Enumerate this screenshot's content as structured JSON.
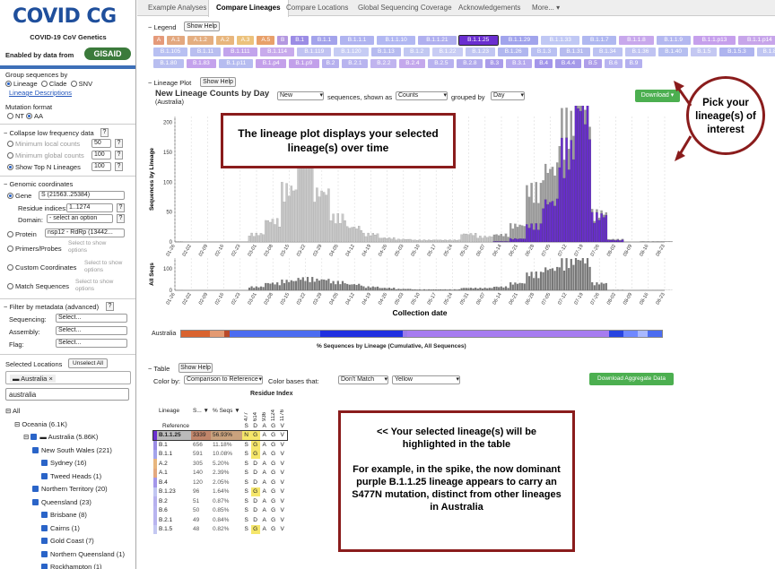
{
  "sidebar": {
    "logo": "COVID CG",
    "subtitle": "COVID-19 CoV Genetics",
    "enabled_by": "Enabled by data from",
    "gisaid": "GISAID",
    "group_seq_label": "Group sequences by",
    "group_options": [
      "Lineage",
      "Clade",
      "SNV"
    ],
    "lineage_desc": "Lineage Descriptions",
    "mutation_format_label": "Mutation format",
    "mutation_options": [
      "NT",
      "AA"
    ],
    "collapse_label": "Collapse low frequency data",
    "min_local_label": "Minimum local counts",
    "min_local_val": "50",
    "min_global_label": "Minimum global counts",
    "min_global_val": "100",
    "top_n_label": "Show Top N Lineages",
    "top_n_val": "100",
    "genomic_label": "Genomic coordinates",
    "gene_label": "Gene",
    "gene_val": "S  (21563..25384)",
    "residue_label": "Residue indices:",
    "residue_val": "1..1274",
    "domain_label": "Domain:",
    "domain_val": "- select an option",
    "protein_label": "Protein",
    "protein_val": "nsp12 - RdRp (13442...",
    "primers_label": "Primers/Probes",
    "custom_label": "Custom Coordinates",
    "match_label": "Match Sequences",
    "select_show": "Select to show options",
    "filter_label": "Filter by metadata (advanced)",
    "sequencing_label": "Sequencing:",
    "assembly_label": "Assembly:",
    "flag_label": "Flag:",
    "select_placeholder": "Select...",
    "selected_loc_label": "Selected Locations",
    "unselect_all": "Unselect All",
    "loc_chip": "Australia",
    "search_val": "australia",
    "tree": [
      {
        "label": "All",
        "indent": 0,
        "type": "minus"
      },
      {
        "label": "Oceania  (6.1K)",
        "indent": 1,
        "type": "minus"
      },
      {
        "label": "Australia  (5.86K)",
        "indent": 2,
        "type": "chkflag"
      },
      {
        "label": "New South Wales  (221)",
        "indent": 3,
        "type": "chk"
      },
      {
        "label": "Sydney  (16)",
        "indent": 4,
        "type": "chk"
      },
      {
        "label": "Tweed Heads  (1)",
        "indent": 4,
        "type": "chk"
      },
      {
        "label": "Northern Territory  (20)",
        "indent": 3,
        "type": "chk"
      },
      {
        "label": "Queensland  (23)",
        "indent": 3,
        "type": "chk"
      },
      {
        "label": "Brisbane  (8)",
        "indent": 4,
        "type": "chk"
      },
      {
        "label": "Cairns  (1)",
        "indent": 4,
        "type": "chk"
      },
      {
        "label": "Gold Coast  (7)",
        "indent": 4,
        "type": "chk"
      },
      {
        "label": "Northern Queensland  (1)",
        "indent": 4,
        "type": "chk"
      },
      {
        "label": "Rockhampton  (1)",
        "indent": 4,
        "type": "chk"
      }
    ]
  },
  "tabs": [
    "Example Analyses",
    "Compare Lineages",
    "Compare Locations",
    "Global Sequencing Coverage",
    "Acknowledgements",
    "More..."
  ],
  "legend": {
    "title": "Legend",
    "show_help": "Show Help",
    "row1": [
      [
        "A",
        "#e59a7a"
      ],
      [
        "A.1",
        "#e3a87f"
      ],
      [
        "A.1.2",
        "#e4ae80"
      ],
      [
        "A.2",
        "#e8b67d"
      ],
      [
        "A.3",
        "#ecc27c"
      ],
      [
        "A.5",
        "#e8a06a"
      ],
      [
        "B",
        "#b498e0"
      ],
      [
        "B.1",
        "#9b8ce5"
      ],
      [
        "B.1.1",
        "#a3a3eb"
      ],
      [
        "B.1.1.1",
        "#b0b4f0"
      ],
      [
        "B.1.1.10",
        "#b2b8f2"
      ],
      [
        "B.1.1.21",
        "#b0b0ef"
      ],
      [
        "B.1.1.25",
        "#6a2ed0"
      ],
      [
        "B.1.1.29",
        "#a1a4ec"
      ],
      [
        "B.1.1.33",
        "#c0c8f4"
      ],
      [
        "B.1.1.7",
        "#b0b8f0"
      ],
      [
        "B.1.1.8",
        "#c8a8ec"
      ],
      [
        "B.1.1.9",
        "#b4b8f0"
      ],
      [
        "B.1.1.p13",
        "#c6a0ec"
      ],
      [
        "B.1.1.p14",
        "#c7a5ea"
      ]
    ],
    "row2": [
      [
        "B.1.105",
        "#b8c0f2"
      ],
      [
        "B.1.11",
        "#b9bef0"
      ],
      [
        "B.1.111",
        "#c2a4ec"
      ],
      [
        "B.1.114",
        "#c8aaec"
      ],
      [
        "B.1.119",
        "#c0c2f2"
      ],
      [
        "B.1.120",
        "#c6ccf4"
      ],
      [
        "B.1.13",
        "#b6bbf0"
      ],
      [
        "B.1.2",
        "#c2c8f2"
      ],
      [
        "B.1.22",
        "#c8ccf4"
      ],
      [
        "B.1.23",
        "#c1c6f2"
      ],
      [
        "B.1.26",
        "#b0b6ef"
      ],
      [
        "B.1.3",
        "#b9c0f2"
      ],
      [
        "B.1.31",
        "#b6bbef"
      ],
      [
        "B.1.34",
        "#bcc2f2"
      ],
      [
        "B.1.36",
        "#c0c4f2"
      ],
      [
        "B.1.40",
        "#b6bff0"
      ],
      [
        "B.1.5",
        "#c4c8f2"
      ],
      [
        "B.1.5.3",
        "#aeb4ef"
      ],
      [
        "B.1.8",
        "#c0c6f2"
      ]
    ],
    "row3": [
      [
        "B.1.80",
        "#b8bef0"
      ],
      [
        "B.1.83",
        "#c4a2ec"
      ],
      [
        "B.1.p11",
        "#b6bcf0"
      ],
      [
        "B.1.p4",
        "#c4a0ea"
      ],
      [
        "B.1.p9",
        "#c2a0ea"
      ],
      [
        "B.2",
        "#b6b0ee"
      ],
      [
        "B.2.1",
        "#b8b4ef"
      ],
      [
        "B.2.2",
        "#c0b4ef"
      ],
      [
        "B.2.4",
        "#c4a8ec"
      ],
      [
        "B.2.5",
        "#b8b2ef"
      ],
      [
        "B.2.8",
        "#b2aaec"
      ],
      [
        "B.3",
        "#aa9cea"
      ],
      [
        "B.3.1",
        "#b6aaee"
      ],
      [
        "B.4",
        "#a396ea"
      ],
      [
        "B.4.4",
        "#a59ae9"
      ],
      [
        "B.5",
        "#ae9ee9"
      ],
      [
        "B.6",
        "#b8b4f0"
      ],
      [
        "B.9",
        "#b4b0ef"
      ]
    ]
  },
  "plot": {
    "section": "Lineage Plot",
    "show_help": "Show Help",
    "title": "New Lineage Counts by Day",
    "subtitle": "(Australia)",
    "new_val": "New",
    "seq_label": "sequences, shown as",
    "counts_val": "Counts",
    "grouped_label": "grouped by",
    "day_val": "Day",
    "download": "Download",
    "ylabel": "Sequences by Lineage",
    "ylabel2": "All Seqs",
    "xlabel": "Collection date",
    "yticks": [
      "0",
      "50",
      "100",
      "150",
      "200"
    ],
    "yticks2": [
      "0",
      "100"
    ],
    "dates": [
      "01-26",
      "02-02",
      "02-09",
      "02-16",
      "02-23",
      "03-01",
      "03-08",
      "03-15",
      "03-22",
      "03-29",
      "04-05",
      "04-12",
      "04-19",
      "04-26",
      "05-03",
      "05-10",
      "05-17",
      "05-24",
      "05-31",
      "06-07",
      "06-14",
      "06-21",
      "06-28",
      "07-05",
      "07-12",
      "07-19",
      "07-26",
      "08-02",
      "08-09",
      "08-16",
      "08-23"
    ],
    "bar_label": "Australia",
    "bar_caption": "% Sequences by Lineage (Cumulative, All Sequences)"
  },
  "chart_data": [
    {
      "type": "bar",
      "title": "New Lineage Counts by Day",
      "subtitle": "(Australia)",
      "xlabel": "Collection date",
      "ylabel": "Sequences by Lineage",
      "ylim": [
        0,
        210
      ],
      "x": [
        "01-26",
        "02-02",
        "02-09",
        "02-16",
        "02-23",
        "03-01",
        "03-08",
        "03-15",
        "03-22",
        "03-29",
        "04-05",
        "04-12",
        "04-19",
        "04-26",
        "05-03",
        "05-10",
        "05-17",
        "05-24",
        "05-31",
        "06-07",
        "06-14",
        "06-21",
        "06-28",
        "07-05",
        "07-12",
        "07-19",
        "07-26",
        "08-02",
        "08-09",
        "08-16",
        "08-23"
      ],
      "series": [
        {
          "name": "Other lineages",
          "values": [
            1,
            0,
            0,
            0,
            0,
            12,
            32,
            80,
            165,
            75,
            38,
            22,
            12,
            6,
            4,
            3,
            3,
            3,
            12,
            8,
            10,
            20,
            55,
            50,
            40,
            25,
            4,
            1,
            0,
            1,
            1
          ]
        },
        {
          "name": "B.1.1.25",
          "values": [
            0,
            0,
            0,
            0,
            0,
            0,
            0,
            0,
            0,
            0,
            0,
            0,
            0,
            0,
            0,
            0,
            0,
            0,
            0,
            0,
            1,
            5,
            25,
            60,
            140,
            205,
            40,
            3,
            0,
            0,
            0
          ]
        }
      ]
    },
    {
      "type": "bar",
      "title": "",
      "ylabel": "All Seqs",
      "ylim": [
        0,
        150
      ],
      "x": [
        "01-26",
        "02-02",
        "02-09",
        "02-16",
        "02-23",
        "03-01",
        "03-08",
        "03-15",
        "03-22",
        "03-29",
        "04-05",
        "04-12",
        "04-19",
        "04-26",
        "05-03",
        "05-10",
        "05-17",
        "05-24",
        "05-31",
        "06-07",
        "06-14",
        "06-21",
        "06-28",
        "07-05",
        "07-12",
        "07-19",
        "07-26",
        "08-02",
        "08-09",
        "08-16",
        "08-23"
      ],
      "series": [
        {
          "name": "All",
          "values": [
            1,
            0,
            0,
            0,
            0,
            15,
            30,
            40,
            50,
            45,
            35,
            25,
            15,
            10,
            6,
            4,
            4,
            4,
            10,
            10,
            15,
            30,
            70,
            90,
            120,
            130,
            30,
            2,
            0,
            1,
            1
          ]
        }
      ]
    }
  ],
  "table_section": {
    "section": "Table",
    "show_help": "Show Help",
    "color_by_label": "Color by:",
    "color_by_val": "Comparison to Reference",
    "color_bases_label": "Color bases that:",
    "color_bases_val": "Don't Match",
    "color_val": "Yellow",
    "download": "Download Aggregate Data",
    "residue_header": "Residue Index",
    "col_lineage": "Lineage",
    "col_s": "S...",
    "col_pct": "% Seqs",
    "residues": [
      "477",
      "614",
      "936",
      "1124",
      "1176"
    ],
    "reference": {
      "label": "Reference",
      "bases": [
        "S",
        "D",
        "A",
        "G",
        "V"
      ]
    },
    "rows": [
      {
        "name": "B.1.1.25",
        "color": "#6a2ed0",
        "count": "3339",
        "pct": "56.93%",
        "bases": [
          "N",
          "G",
          "A",
          "G",
          "V"
        ],
        "hl": [
          1,
          1,
          0,
          0,
          0
        ],
        "sel": true
      },
      {
        "name": "B.1",
        "color": "#9b8ce5",
        "count": "656",
        "pct": "11.18%",
        "bases": [
          "S",
          "G",
          "A",
          "G",
          "V"
        ],
        "hl": [
          0,
          1,
          0,
          0,
          0
        ]
      },
      {
        "name": "B.1.1",
        "color": "#a3a3eb",
        "count": "591",
        "pct": "10.08%",
        "bases": [
          "S",
          "G",
          "A",
          "G",
          "V"
        ],
        "hl": [
          0,
          1,
          0,
          0,
          0
        ]
      },
      {
        "name": "A.2",
        "color": "#e8b67d",
        "count": "305",
        "pct": "5.20%",
        "bases": [
          "S",
          "D",
          "A",
          "G",
          "V"
        ],
        "hl": [
          0,
          0,
          0,
          0,
          0
        ]
      },
      {
        "name": "A.1",
        "color": "#e3a87f",
        "count": "140",
        "pct": "2.39%",
        "bases": [
          "S",
          "D",
          "A",
          "G",
          "V"
        ],
        "hl": [
          0,
          0,
          0,
          0,
          0
        ]
      },
      {
        "name": "B.4",
        "color": "#a396ea",
        "count": "120",
        "pct": "2.05%",
        "bases": [
          "S",
          "D",
          "A",
          "G",
          "V"
        ],
        "hl": [
          0,
          0,
          0,
          0,
          0
        ]
      },
      {
        "name": "B.1.23",
        "color": "#c1c6f2",
        "count": "96",
        "pct": "1.64%",
        "bases": [
          "S",
          "G",
          "A",
          "G",
          "V"
        ],
        "hl": [
          0,
          1,
          0,
          0,
          0
        ]
      },
      {
        "name": "B.2",
        "color": "#b6b0ee",
        "count": "51",
        "pct": "0.87%",
        "bases": [
          "S",
          "D",
          "A",
          "G",
          "V"
        ],
        "hl": [
          0,
          0,
          0,
          0,
          0
        ]
      },
      {
        "name": "B.6",
        "color": "#b8b4f0",
        "count": "50",
        "pct": "0.85%",
        "bases": [
          "S",
          "D",
          "A",
          "G",
          "V"
        ],
        "hl": [
          0,
          0,
          0,
          0,
          0
        ]
      },
      {
        "name": "B.2.1",
        "color": "#b8b4ef",
        "count": "49",
        "pct": "0.84%",
        "bases": [
          "S",
          "D",
          "A",
          "G",
          "V"
        ],
        "hl": [
          0,
          0,
          0,
          0,
          0
        ]
      },
      {
        "name": "B.1.5",
        "color": "#c4c8f2",
        "count": "48",
        "pct": "0.82%",
        "bases": [
          "S",
          "G",
          "A",
          "G",
          "V"
        ],
        "hl": [
          0,
          1,
          0,
          0,
          0
        ]
      }
    ]
  },
  "callouts": {
    "plot_note": "The lineage plot displays your selected lineage(s) over time",
    "pick": "Pick your lineage(s) of interest",
    "table_note_1": "<< Your selected lineage(s) will be highlighted in the table",
    "table_note_2": "For example, in the spike, the now dominant purple B.1.1.25 lineage appears to carry an S477N mutation, distinct from other lineages in Australia"
  }
}
